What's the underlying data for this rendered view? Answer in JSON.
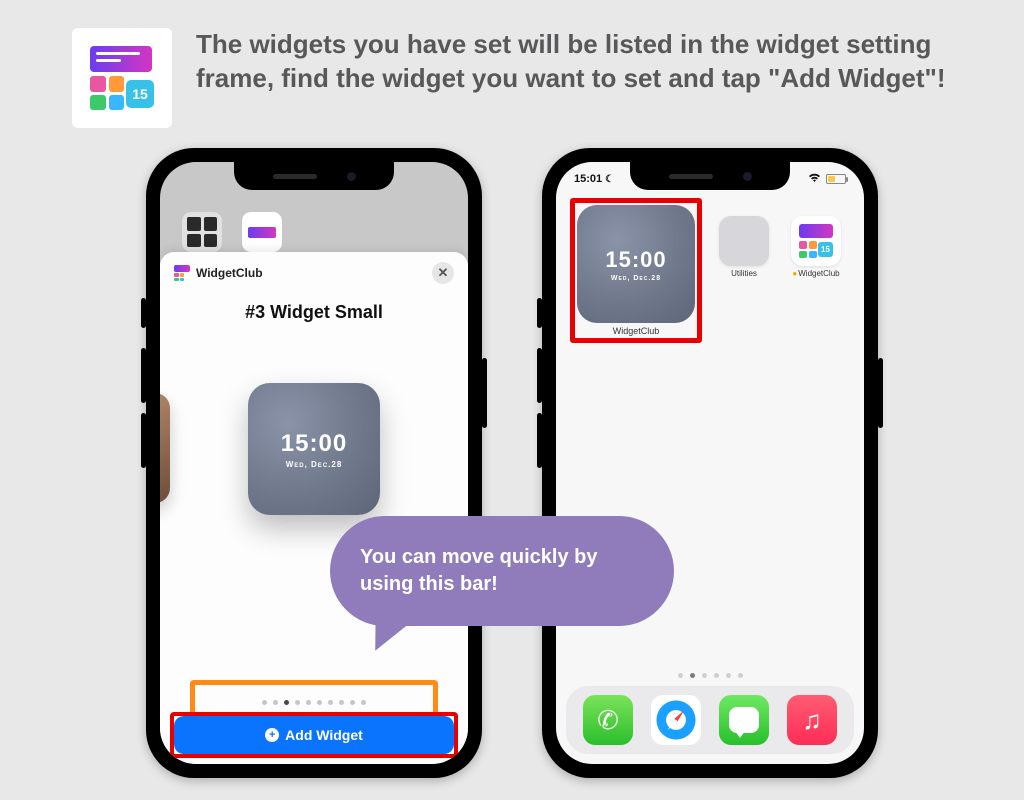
{
  "header": {
    "badge_text": "15",
    "instruction": "The widgets you have set will be listed in the widget setting frame, find the widget you want to set and tap \"Add Widget\"!"
  },
  "bubble_text": "You can move quickly by using this bar!",
  "phone1": {
    "sheet_app_name": "WidgetClub",
    "sheet_title": "#3 Widget Small",
    "widget_time": "15:00",
    "widget_date": "Wed, Dec.28",
    "add_button_label": "Add Widget"
  },
  "phone2": {
    "status_time": "15:01",
    "widget_time": "15:00",
    "widget_date": "Wed, Dec.28",
    "widget_label": "WidgetClub",
    "app_utilities_label": "Utilities",
    "app_widgetclub_label": "WidgetClub",
    "wc_badge": "15"
  }
}
